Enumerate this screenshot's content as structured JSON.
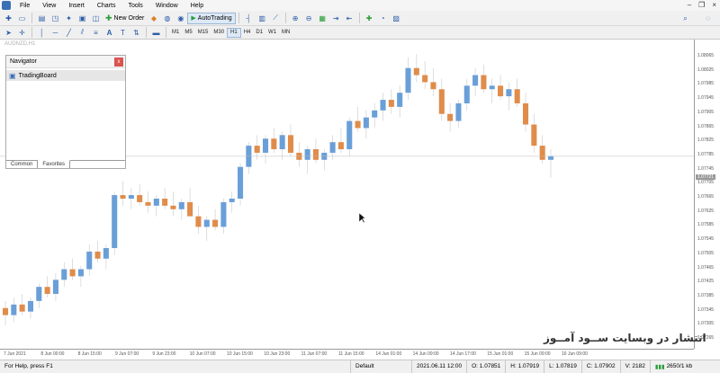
{
  "menubar": {
    "items": [
      "File",
      "View",
      "Insert",
      "Charts",
      "Tools",
      "Window",
      "Help"
    ]
  },
  "toolbar": {
    "new_order_label": "New Order",
    "autotrading_label": "AutoTrading",
    "timeframes": [
      "M1",
      "M5",
      "M15",
      "M30",
      "H1",
      "H4",
      "D1",
      "W1",
      "MN"
    ],
    "active_timeframe": "H1"
  },
  "chart": {
    "title": "AUDNZD,H1",
    "watermark": "انتشار در وبسایت ســود آمــوز",
    "bull_color": "#6a9fd8",
    "bear_color": "#e08c4a"
  },
  "navigator": {
    "title": "Navigator",
    "item": "TradingBoard",
    "tabs": [
      "Common",
      "Favorites"
    ],
    "active_tab": "Favorites"
  },
  "chart_data": {
    "type": "candlestick",
    "symbol": "AUDNZD",
    "timeframe": "H1",
    "ylim": [
      1.0725,
      1.0807
    ],
    "price_ticks": [
      "1.08065",
      "1.08025",
      "1.07985",
      "1.07945",
      "1.07905",
      "1.07865",
      "1.07825",
      "1.07785",
      "1.07745",
      "1.07705",
      "1.07665",
      "1.07625",
      "1.07585",
      "1.07545",
      "1.07505",
      "1.07465",
      "1.07425",
      "1.07385",
      "1.07345",
      "1.07305",
      "1.07265"
    ],
    "current_price": "1.07721",
    "time_ticks": [
      "7 Jun 2021",
      "8 Jun 00:00",
      "8 Jun 15:00",
      "9 Jun 07:00",
      "9 Jun 23:00",
      "10 Jun 07:00",
      "10 Jun 15:00",
      "10 Jun 23:00",
      "11 Jun 07:00",
      "11 Jun 15:00",
      "14 Jun 01:00",
      "14 Jun 09:00",
      "14 Jun 17:00",
      "15 Jun 01:00",
      "15 Jun 09:00",
      "16 Jun 09:00"
    ],
    "ohlc": [
      [
        1.0735,
        1.0737,
        1.073,
        1.0733
      ],
      [
        1.0733,
        1.0738,
        1.0731,
        1.0736
      ],
      [
        1.0736,
        1.0739,
        1.0733,
        1.0734
      ],
      [
        1.0734,
        1.0738,
        1.0732,
        1.0737
      ],
      [
        1.0737,
        1.0742,
        1.0735,
        1.0741
      ],
      [
        1.0741,
        1.0744,
        1.0738,
        1.0739
      ],
      [
        1.0739,
        1.0745,
        1.0737,
        1.0743
      ],
      [
        1.0743,
        1.0748,
        1.0741,
        1.0746
      ],
      [
        1.0746,
        1.0749,
        1.0743,
        1.0744
      ],
      [
        1.0744,
        1.0747,
        1.0741,
        1.0746
      ],
      [
        1.0746,
        1.0753,
        1.0744,
        1.0751
      ],
      [
        1.0751,
        1.0754,
        1.0748,
        1.0749
      ],
      [
        1.0749,
        1.0753,
        1.0746,
        1.0752
      ],
      [
        1.0752,
        1.0768,
        1.075,
        1.0767
      ],
      [
        1.0767,
        1.0771,
        1.0764,
        1.0766
      ],
      [
        1.0766,
        1.0769,
        1.0763,
        1.0767
      ],
      [
        1.0767,
        1.077,
        1.0764,
        1.0765
      ],
      [
        1.0765,
        1.0768,
        1.0762,
        1.0764
      ],
      [
        1.0764,
        1.0767,
        1.0761,
        1.0766
      ],
      [
        1.0766,
        1.0769,
        1.0763,
        1.0764
      ],
      [
        1.0764,
        1.0768,
        1.0761,
        1.0763
      ],
      [
        1.0763,
        1.0766,
        1.076,
        1.0765
      ],
      [
        1.0765,
        1.0769,
        1.0762,
        1.0761
      ],
      [
        1.0761,
        1.0764,
        1.0756,
        1.0758
      ],
      [
        1.0758,
        1.0761,
        1.0754,
        1.076
      ],
      [
        1.076,
        1.0763,
        1.0757,
        1.0758
      ],
      [
        1.0758,
        1.0766,
        1.0756,
        1.0765
      ],
      [
        1.0765,
        1.0768,
        1.0762,
        1.0766
      ],
      [
        1.0766,
        1.0776,
        1.0764,
        1.0775
      ],
      [
        1.0775,
        1.0782,
        1.0773,
        1.0781
      ],
      [
        1.0781,
        1.0784,
        1.0777,
        1.0779
      ],
      [
        1.0779,
        1.0784,
        1.0776,
        1.0783
      ],
      [
        1.0783,
        1.0786,
        1.0779,
        1.078
      ],
      [
        1.078,
        1.0785,
        1.0777,
        1.0784
      ],
      [
        1.0784,
        1.0787,
        1.0778,
        1.0779
      ],
      [
        1.0779,
        1.0782,
        1.0775,
        1.0777
      ],
      [
        1.0777,
        1.0781,
        1.0773,
        1.078
      ],
      [
        1.078,
        1.0783,
        1.0776,
        1.0777
      ],
      [
        1.0777,
        1.078,
        1.0774,
        1.0779
      ],
      [
        1.0779,
        1.0784,
        1.0777,
        1.0782
      ],
      [
        1.0782,
        1.0786,
        1.0779,
        1.078
      ],
      [
        1.078,
        1.0789,
        1.0778,
        1.0788
      ],
      [
        1.0788,
        1.0792,
        1.0785,
        1.0786
      ],
      [
        1.0786,
        1.0791,
        1.0783,
        1.0789
      ],
      [
        1.0789,
        1.0793,
        1.0786,
        1.0791
      ],
      [
        1.0791,
        1.0796,
        1.0788,
        1.0794
      ],
      [
        1.0794,
        1.0797,
        1.079,
        1.0792
      ],
      [
        1.0792,
        1.0798,
        1.0789,
        1.0796
      ],
      [
        1.0796,
        1.0806,
        1.0794,
        1.0803
      ],
      [
        1.0803,
        1.0807,
        1.0799,
        1.0801
      ],
      [
        1.0801,
        1.0805,
        1.0797,
        1.0799
      ],
      [
        1.0799,
        1.0803,
        1.0795,
        1.0797
      ],
      [
        1.0797,
        1.08,
        1.0788,
        1.079
      ],
      [
        1.079,
        1.0793,
        1.0785,
        1.0788
      ],
      [
        1.0788,
        1.0794,
        1.0786,
        1.0793
      ],
      [
        1.0793,
        1.08,
        1.0791,
        1.0798
      ],
      [
        1.0798,
        1.0803,
        1.0795,
        1.0801
      ],
      [
        1.0801,
        1.0804,
        1.0796,
        1.0797
      ],
      [
        1.0797,
        1.08,
        1.0793,
        1.0798
      ],
      [
        1.0798,
        1.0801,
        1.0794,
        1.0795
      ],
      [
        1.0795,
        1.0799,
        1.0791,
        1.0797
      ],
      [
        1.0797,
        1.08,
        1.0792,
        1.0793
      ],
      [
        1.0793,
        1.0796,
        1.0785,
        1.0787
      ],
      [
        1.0787,
        1.079,
        1.0779,
        1.0781
      ],
      [
        1.0781,
        1.0784,
        1.0776,
        1.0777
      ],
      [
        1.0777,
        1.078,
        1.0772,
        1.0778
      ]
    ]
  },
  "status": {
    "help": "For Help, press F1",
    "profile": "Default",
    "datetime": "2021.06.11 12:00",
    "open": "O: 1.07851",
    "high": "H: 1.07919",
    "low": "L: 1.07819",
    "close": "C: 1.07902",
    "volume": "V: 2182",
    "traffic": "2650/1 kb"
  }
}
